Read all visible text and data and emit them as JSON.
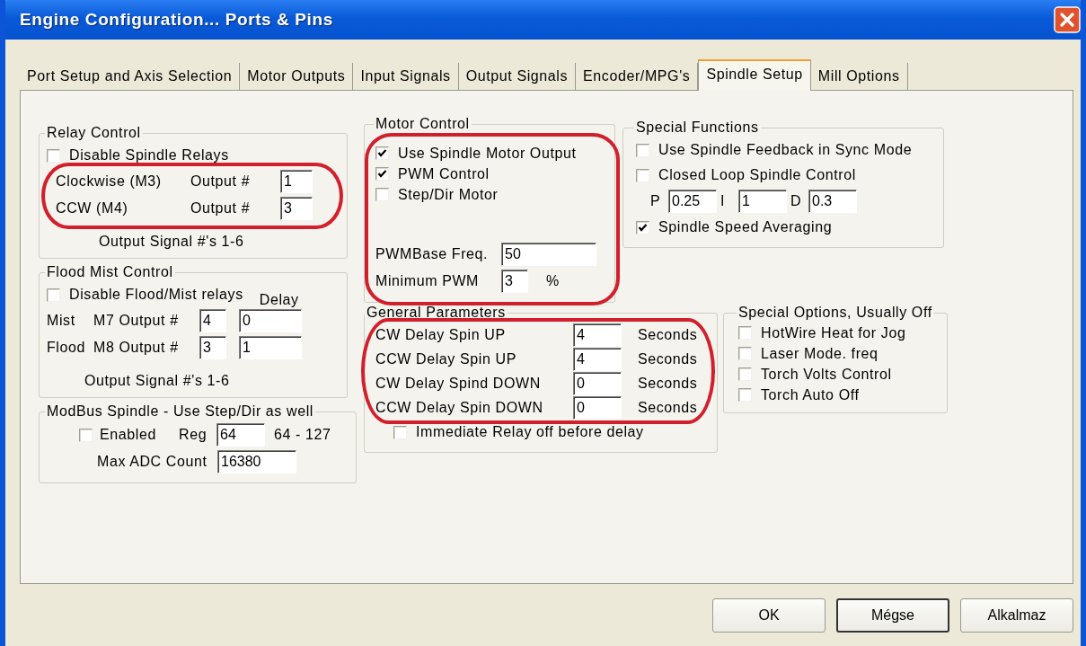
{
  "window": {
    "title": "Engine Configuration... Ports & Pins"
  },
  "tabs": [
    {
      "label": "Port Setup and Axis Selection",
      "selected": false
    },
    {
      "label": "Motor Outputs",
      "selected": false
    },
    {
      "label": "Input Signals",
      "selected": false
    },
    {
      "label": "Output Signals",
      "selected": false
    },
    {
      "label": "Encoder/MPG's",
      "selected": false
    },
    {
      "label": "Spindle Setup",
      "selected": true
    },
    {
      "label": "Mill Options",
      "selected": false
    }
  ],
  "relay_control": {
    "title": "Relay Control",
    "circled": true,
    "checkbox": {
      "label": "Disable Spindle Relays",
      "checked": false
    },
    "outputs": [
      {
        "label": "Clockwise (M3)",
        "output_label": "Output #",
        "value": "1"
      },
      {
        "label": "CCW (M4)",
        "output_label": "Output #",
        "value": "3"
      }
    ],
    "note": "Output Signal #'s 1-6"
  },
  "flood_mist": {
    "title": "Flood Mist Control",
    "checkbox": {
      "label": "Disable Flood/Mist relays",
      "checked": false
    },
    "delay_label": "Delay",
    "rows": [
      {
        "label": "Mist",
        "output_label": "M7 Output #",
        "value": "4",
        "delay": "0"
      },
      {
        "label": "Flood",
        "output_label": "M8 Output #",
        "value": "3",
        "delay": "1"
      }
    ],
    "note": "Output Signal #'s 1-6"
  },
  "modbus": {
    "title": "ModBus Spindle - Use Step/Dir as well",
    "enabled": {
      "label": "Enabled",
      "checked": false
    },
    "reg_label": "Reg",
    "reg": "64",
    "range": "64 - 127",
    "max_label": "Max ADC Count",
    "max": "16380"
  },
  "motor_control": {
    "title": "Motor Control",
    "circled": true,
    "checkboxes": [
      {
        "label": "Use Spindle Motor Output",
        "checked": true
      },
      {
        "label": "PWM Control",
        "checked": true
      },
      {
        "label": "Step/Dir Motor",
        "checked": false
      }
    ],
    "freq_label": "PWMBase Freq.",
    "freq": "50",
    "min_label": "Minimum PWM",
    "min": "3",
    "unit": "%"
  },
  "special_functions": {
    "title": "Special Functions",
    "checkboxes": [
      {
        "label": "Use Spindle Feedback in Sync Mode",
        "checked": false
      },
      {
        "label": "Closed Loop Spindle Control",
        "checked": false
      }
    ],
    "pid": [
      {
        "label": "P",
        "value": "0.25"
      },
      {
        "label": "I",
        "value": "1"
      },
      {
        "label": "D",
        "value": "0.3"
      }
    ],
    "averaging": {
      "label": "Spindle Speed Averaging",
      "checked": true
    }
  },
  "general": {
    "title": "General Parameters",
    "circled": true,
    "rows": [
      {
        "label": "CW Delay Spin UP",
        "value": "4",
        "unit": "Seconds"
      },
      {
        "label": "CCW Delay Spin UP",
        "value": "4",
        "unit": "Seconds"
      },
      {
        "label": "CW Delay Spind DOWN",
        "value": "0",
        "unit": "Seconds"
      },
      {
        "label": "CCW Delay Spin DOWN",
        "value": "0",
        "unit": "Seconds"
      }
    ],
    "immediate": {
      "label": "Immediate Relay off before delay",
      "checked": false
    }
  },
  "special_options": {
    "title": "Special Options, Usually Off",
    "checkboxes": [
      {
        "label": "HotWire Heat for Jog",
        "checked": false
      },
      {
        "label": "Laser Mode. freq",
        "checked": false
      },
      {
        "label": "Torch Volts Control",
        "checked": false
      },
      {
        "label": "Torch Auto Off",
        "checked": false
      }
    ]
  },
  "buttons": [
    {
      "label": "OK",
      "focused": false
    },
    {
      "label": "Mégse",
      "focused": true
    },
    {
      "label": "Alkalmaz",
      "focused": false
    }
  ]
}
